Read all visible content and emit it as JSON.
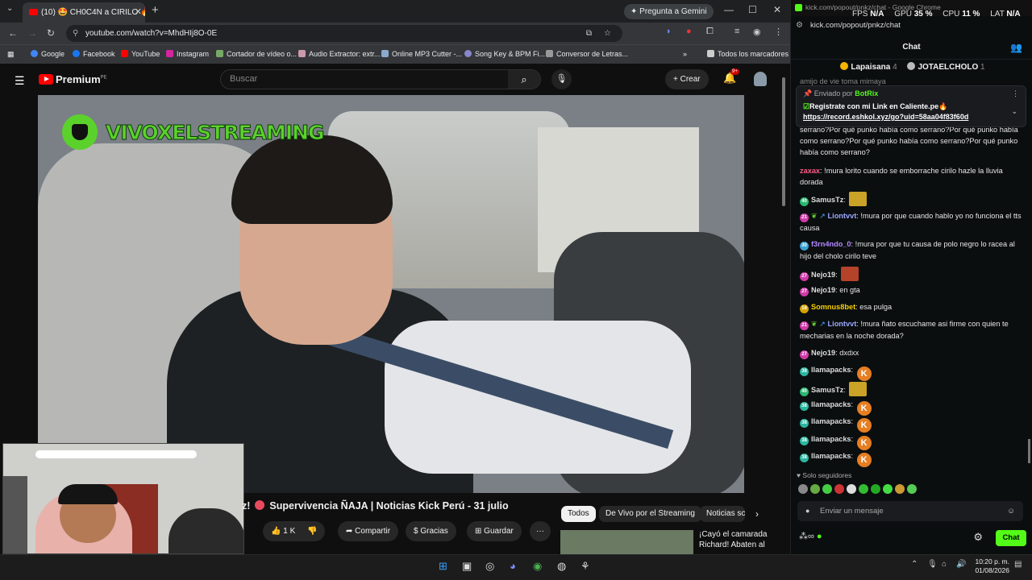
{
  "browser": {
    "tab_title": "(10) 🤩 CH0C4N a CIRILO 🔥🔊",
    "gemini_label": "Pregunta a Gemini",
    "url": "youtube.com/watch?v=MhdHIj8O-0E",
    "bookmarks": [
      "Google",
      "Facebook",
      "YouTube",
      "Instagram",
      "Cortador de vídeo o...",
      "Audio Extractor: extr...",
      "Online MP3 Cutter -...",
      "Song Key & BPM Fi...",
      "Conversor de Letras..."
    ],
    "all_bookmarks": "Todos los marcadores"
  },
  "youtube": {
    "logo": "Premium",
    "logo_sup": "PE",
    "search_placeholder": "Buscar",
    "create_label": "Crear",
    "notif_count": "9+",
    "watermark": "VIVOXELSTREAMING",
    "video_title_prefix": "z!",
    "video_title": "Supervivencia ÑAJA | Noticias Kick Perú - 31 julio",
    "like_count": "1 K",
    "share": "Compartir",
    "thanks": "Gracias",
    "save": "Guardar",
    "chips": [
      "Todos",
      "De Vivo por el Streaming",
      "Noticias sc"
    ],
    "rec_title": "¡Cayó el camarada Richard! Abaten al"
  },
  "kick": {
    "window_title": "kick.com/popout/pnkz/chat - Google Chrome",
    "stats": {
      "fps_label": "FPS",
      "fps": "N/A",
      "gpu_label": "GPU",
      "gpu": "35 %",
      "cpu_label": "CPU",
      "cpu": "11 %",
      "lat_label": "LAT",
      "lat": "N/A"
    },
    "url": "kick.com/popout/pnkz/chat",
    "header": "Chat",
    "gifters": [
      {
        "name": "Lapaisana",
        "count": "4"
      },
      {
        "name": "JOTAELCHOLO",
        "count": "1"
      }
    ],
    "partial_top": "amijo de vie toma mimaya",
    "pinned": {
      "sent_by": "Enviado por",
      "user": "BotRix",
      "line1": "Registrate con mi Link en Caliente.pe🔥",
      "link": "https://record.eshkol.xyz/go?uid=58aa04f83f60d"
    },
    "messages": [
      {
        "user": "",
        "badge": "",
        "text": "serrano?Por qué punko había como serrano?Por qué punko había como serrano?Por qué punko había como serrano?Por qué punko había como serrano?",
        "color": "#e6e6e6"
      },
      {
        "user": "zaxax",
        "badge": "",
        "text": "!mura lorito cuando se emborrache cirilo hazle la lluvia dorada",
        "color": "#ff5c8a"
      },
      {
        "user": "SamusTz",
        "badge": "40",
        "text": "",
        "color": "#dcdcdc",
        "emote": "img"
      },
      {
        "user": "Liontvvt",
        "badge": "21",
        "text": "!mura por que cuando hablo yo no funciona el tts causa",
        "color": "#9ba7ff"
      },
      {
        "user": "f3rn4ndo_0",
        "badge": "30",
        "text": "!mura por que tu causa de polo negro lo racea al hijo del cholo cirilo teve",
        "color": "#b388ff"
      },
      {
        "user": "Nejo19",
        "badge": "27",
        "text": "",
        "color": "#dcdcdc",
        "emote": "face"
      },
      {
        "user": "Nejo19",
        "badge": "27",
        "text": "en gta",
        "color": "#dcdcdc"
      },
      {
        "user": "Somnus8bet",
        "badge": "16",
        "text": "esa pulga",
        "color": "#f5d000"
      },
      {
        "user": "Liontvvt",
        "badge": "21",
        "text": "!mura ñato escuchame asi firme con quien te mecharias en la noche dorada?",
        "color": "#9ba7ff"
      },
      {
        "user": "Nejo19",
        "badge": "27",
        "text": "dxdxx",
        "color": "#dcdcdc"
      },
      {
        "user": "llamapacks",
        "badge": "38",
        "text": "",
        "color": "#dcdcdc",
        "emote": "k"
      },
      {
        "user": "SamusTz",
        "badge": "40",
        "text": "",
        "color": "#dcdcdc",
        "emote": "img"
      },
      {
        "user": "llamapacks",
        "badge": "38",
        "text": "",
        "color": "#dcdcdc",
        "emote": "k"
      },
      {
        "user": "llamapacks",
        "badge": "38",
        "text": "",
        "color": "#dcdcdc",
        "emote": "k"
      },
      {
        "user": "llamapacks",
        "badge": "38",
        "text": "",
        "color": "#dcdcdc",
        "emote": "k"
      },
      {
        "user": "llamapacks",
        "badge": "38",
        "text": "",
        "color": "#dcdcdc",
        "emote": "k"
      }
    ],
    "followers_only": "Solo seguidores",
    "input_placeholder": "Enviar un mensaje",
    "chat_button": "Chat"
  },
  "taskbar": {
    "time": "10:20 p. m.",
    "date": "01/08/2026"
  },
  "colors": {
    "kick_green": "#53fc18",
    "yt_red": "#ff0000"
  }
}
